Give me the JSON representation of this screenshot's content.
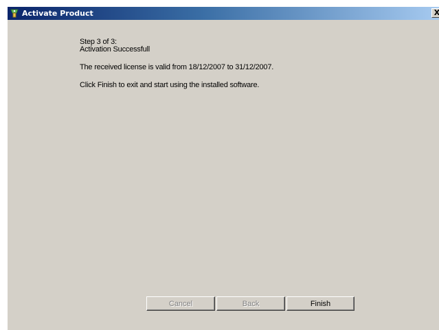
{
  "window": {
    "title": "Activate Product",
    "close_glyph": "X"
  },
  "content": {
    "step": "Step 3 of 3:",
    "status": "Activation Successfull",
    "license_text": "The received license is valid from 18/12/2007 to 31/12/2007.",
    "instruction": "Click Finish to exit and start using the installed software."
  },
  "buttons": {
    "cancel": "Cancel",
    "back": "Back",
    "finish": "Finish"
  },
  "icons": {
    "title_icon": "product-key-icon"
  }
}
